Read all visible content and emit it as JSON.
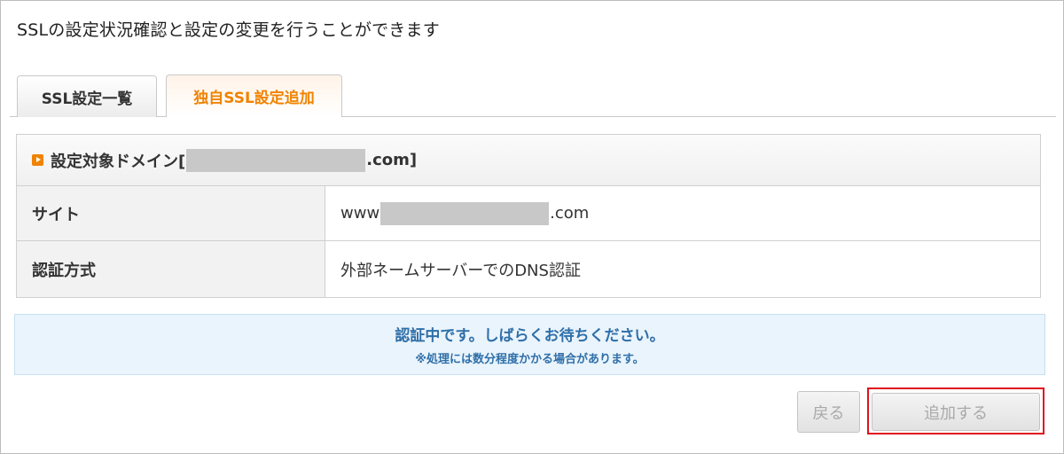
{
  "description": "SSLの設定状況確認と設定の変更を行うことができます",
  "tabs": [
    {
      "label": "SSL設定一覧",
      "active": false
    },
    {
      "label": "独自SSL設定追加",
      "active": true
    }
  ],
  "table": {
    "heading_prefix": "設定対象ドメイン[",
    "heading_suffix": ".com]",
    "rows": [
      {
        "label": "サイト",
        "value_prefix": "www",
        "value_suffix": ".com"
      },
      {
        "label": "認証方式",
        "value": "外部ネームサーバーでのDNS認証"
      }
    ]
  },
  "status": {
    "message": "認証中です。しばらくお待ちください。",
    "note": "※処理には数分程度かかる場合があります。"
  },
  "buttons": {
    "back": "戻る",
    "add": "追加する"
  },
  "colors": {
    "accent": "#f08300",
    "status_text": "#2f6fa8",
    "status_bg": "#eaf4fc",
    "highlight": "#e0101e"
  },
  "icons": {
    "heading": "orange-play-icon"
  }
}
